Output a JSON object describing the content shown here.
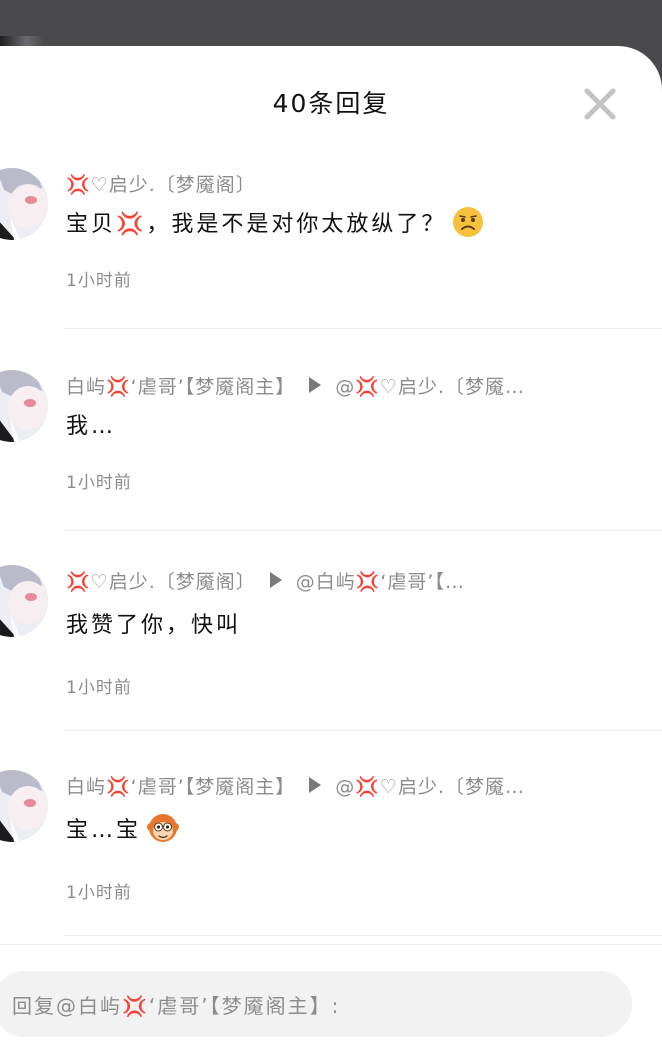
{
  "sheet": {
    "title": "40条回复",
    "close_icon": "close-x-icon"
  },
  "comments": [
    {
      "author": "💢♡启少.〔梦魇阁〕",
      "target": "",
      "text": "宝贝💢，我是不是对你太放纵了？",
      "emoji": "frowning-face",
      "time": "1小时前"
    },
    {
      "author": "白屿💢‘虐哥’【梦魇阁主】",
      "target": "@💢♡启少.〔梦魇…",
      "text": "我…",
      "emoji": "",
      "time": "1小时前"
    },
    {
      "author": "💢♡启少.〔梦魇阁〕",
      "target": "@白屿💢‘虐哥’【…",
      "text": "我赞了你，快叫",
      "emoji": "",
      "time": "1小时前"
    },
    {
      "author": "白屿💢‘虐哥’【梦魇阁主】",
      "target": "@💢♡启少.〔梦魇…",
      "text": "宝…宝",
      "emoji": "monkey-sticker",
      "time": "1小时前"
    }
  ],
  "reply_bar": {
    "placeholder": "回复@白屿💢‘虐哥’【梦魇阁主】:"
  },
  "colors": {
    "backdrop": "#4a4a4c",
    "sheet": "#ffffff",
    "secondary_text": "#8c8c8c",
    "primary_text": "#111111",
    "divider": "#ececec",
    "input_bg": "#f2f2f2"
  }
}
